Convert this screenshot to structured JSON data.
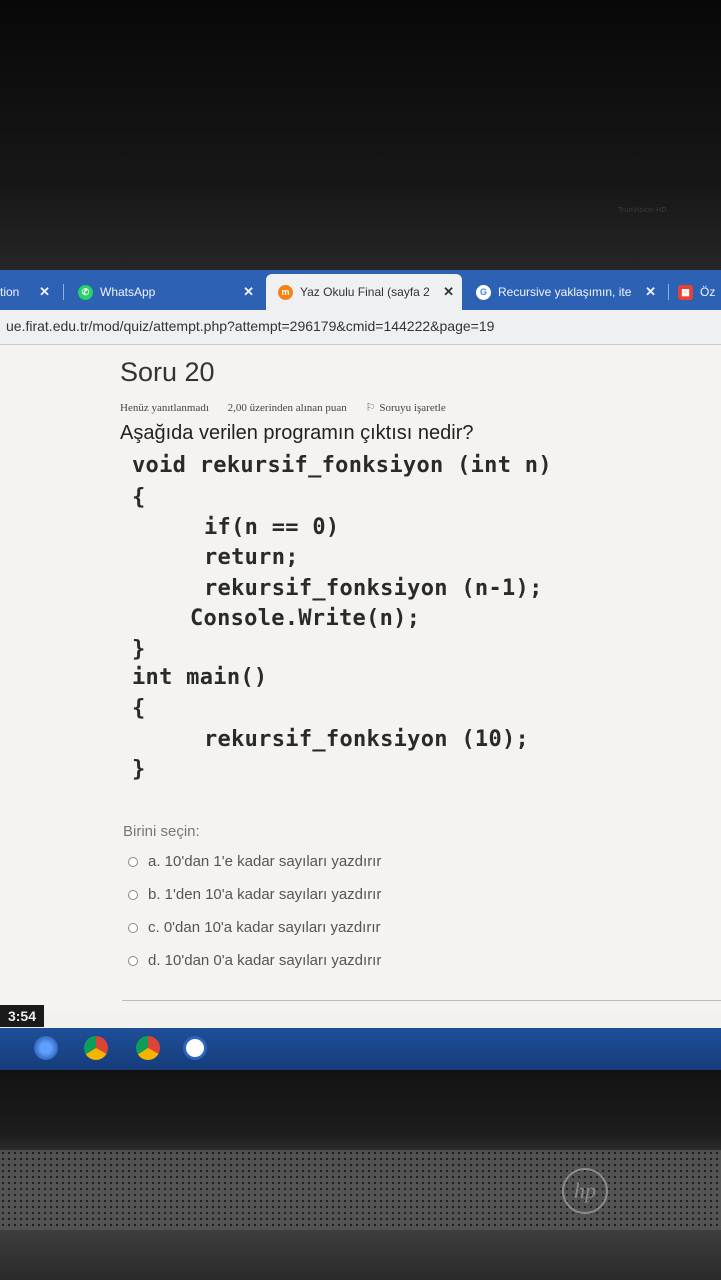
{
  "bezel": {
    "webcam_label": "TrueVision HD"
  },
  "tabs": [
    {
      "label": "tion",
      "close": "✕",
      "favicon": ""
    },
    {
      "label": "WhatsApp",
      "close": "✕",
      "favicon": "whatsapp-icon"
    },
    {
      "label": "Yaz Okulu Final (sayfa 2",
      "close": "✕",
      "favicon": "moodle-icon"
    },
    {
      "label": "Recursive yaklaşımın, ite",
      "close": "✕",
      "favicon": "google-icon"
    },
    {
      "label": "Öz",
      "favicon": "app-icon"
    }
  ],
  "url": "ue.firat.edu.tr/mod/quiz/attempt.php?attempt=296179&cmid=144222&page=19",
  "question": {
    "title": "Soru 20",
    "status": "Henüz yanıtlanmadı",
    "points": "2,00 üzerinden alınan puan",
    "flag_label": "Soruyu işaretle",
    "text": "Aşağıda verilen programın çıktısı nedir?"
  },
  "code_lines": [
    "void rekursif_fonksiyon (int n)",
    "{",
    "if(n == 0)",
    "return;",
    "rekursif_fonksiyon (n-1);",
    "Console.Write(n);",
    "}",
    "int main()",
    "{",
    "rekursif_fonksiyon (10);",
    "}"
  ],
  "choose_label": "Birini seçin:",
  "options": [
    "a. 10'dan 1'e kadar sayıları yazdırır",
    "b. 1'den 10'a kadar sayıları yazdırır",
    "c. 0'dan 10'a kadar sayıları yazdırır",
    "d. 10'dan 0'a kadar sayıları yazdırır"
  ],
  "taskbar": {
    "clock": "3:54"
  },
  "brand": {
    "logo": "hp"
  },
  "colors": {
    "taskbar": "#1e4f9a",
    "tabstrip": "#2c61b4",
    "whatsapp": "#25d366",
    "moodle": "#f98012",
    "google": "#4285f4",
    "chrome_red": "#db4437",
    "chrome_yellow": "#f4b400"
  }
}
